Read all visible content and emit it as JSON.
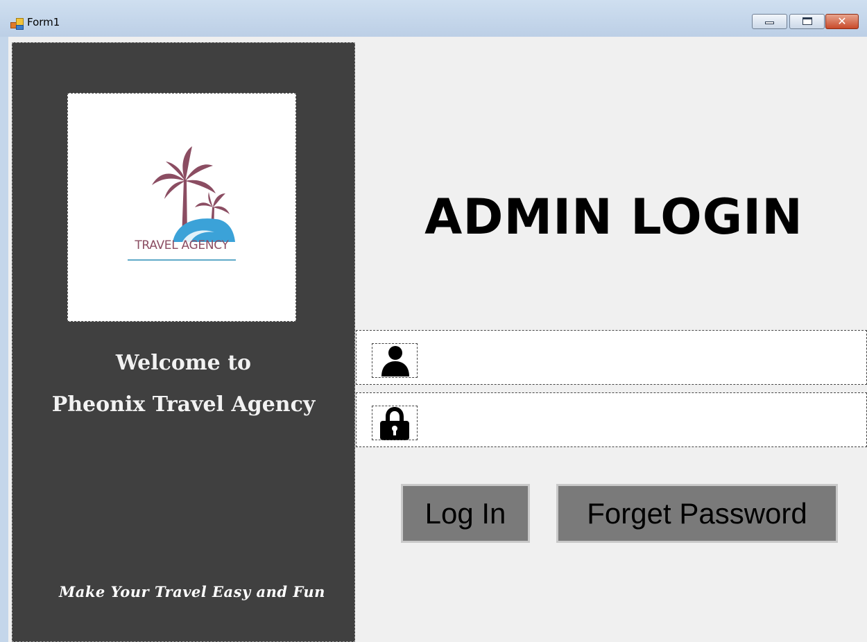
{
  "window": {
    "title": "Form1",
    "icon": "winforms-app-icon",
    "controls": {
      "minimize_icon": "minimize-icon",
      "maximize_icon": "maximize-icon",
      "close_icon": "close-icon",
      "close_glyph": "✕"
    }
  },
  "sidebar": {
    "logo_text": "TRAVEL AGENCY",
    "welcome_line1": "Welcome to",
    "welcome_line2": "Pheonix Travel Agency",
    "tagline": "Make Your Travel Easy and Fun"
  },
  "login": {
    "heading": "ADMIN LOGIN",
    "username": {
      "value": "",
      "placeholder": "",
      "icon": "user-icon"
    },
    "password": {
      "value": "",
      "placeholder": "",
      "icon": "lock-icon"
    },
    "login_button": "Log In",
    "forget_button": "Forget Password"
  },
  "colors": {
    "sidebar_bg": "#404040",
    "client_bg": "#f0f0f0",
    "button_bg": "#7a7a7a",
    "logo_palm": "#8b4d62",
    "logo_wave": "#3ba2d8"
  }
}
